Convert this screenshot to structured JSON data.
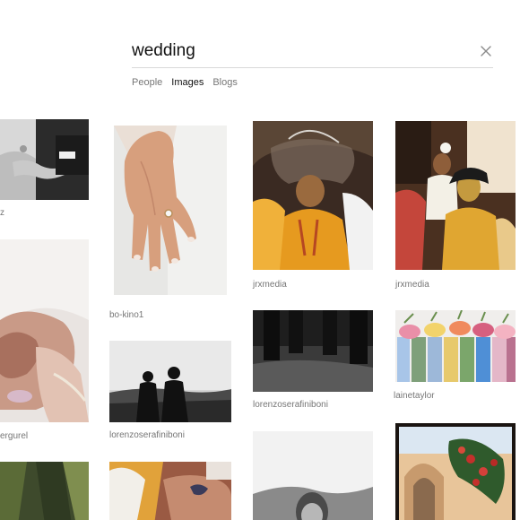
{
  "search": {
    "query": "wedding",
    "clear_icon": "close-icon"
  },
  "tabs": [
    {
      "label": "People",
      "active": false
    },
    {
      "label": "Images",
      "active": true
    },
    {
      "label": "Blogs",
      "active": false
    }
  ],
  "results": {
    "col1": [
      {
        "photo": "couple-holding-hands-bw",
        "credit": "z"
      },
      {
        "photo": "veil-kiss",
        "credit": "ergurel"
      },
      {
        "photo": "forest",
        "credit": ""
      }
    ],
    "col2": [
      {
        "photo": "engagement-ring-hand",
        "credit": "bo-kino1"
      },
      {
        "photo": "silhouette-couple-bw",
        "credit": "lorenzoserafiniboni"
      },
      {
        "photo": "tattooed-arm",
        "credit": ""
      }
    ],
    "col3": [
      {
        "photo": "haldi-ceremony",
        "credit": "jrxmedia"
      },
      {
        "photo": "bw-grass-legs",
        "credit": "lorenzoserafiniboni"
      },
      {
        "photo": "smiling-woman",
        "credit": ""
      }
    ],
    "col4": [
      {
        "photo": "haldi-groom",
        "credit": "jrxmedia"
      },
      {
        "photo": "bridesmaids-bouquets",
        "credit": "lainetaylor"
      },
      {
        "photo": "arch-flowers",
        "credit": ""
      }
    ]
  }
}
